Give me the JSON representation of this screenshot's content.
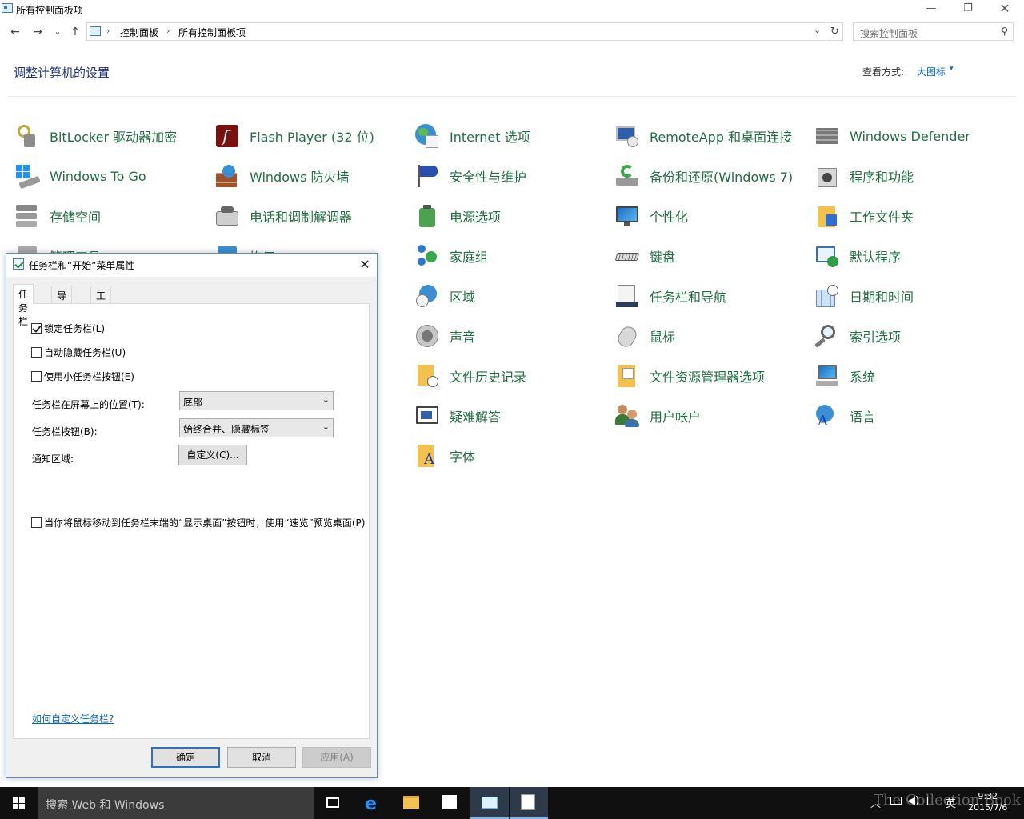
{
  "window": {
    "title": "所有控制面板项",
    "minimize": "—",
    "maximize": "❐",
    "close": "✕"
  },
  "nav": {
    "back": "←",
    "forward": "→",
    "recent": "⌄",
    "up": "↑",
    "breadcrumb": [
      "控制面板",
      "所有控制面板项"
    ],
    "separator": "›",
    "dropdown": "⌄",
    "refresh": "↻"
  },
  "search": {
    "placeholder": "搜索控制面板",
    "icon": "⚲"
  },
  "header": {
    "title": "调整计算机的设置",
    "view_by_label": "查看方式:",
    "view_by_value": "大图标",
    "view_by_arrow": "▾"
  },
  "items": [
    "BitLocker 驱动器加密",
    "Flash Player (32 位)",
    "Internet 选项",
    "RemoteApp 和桌面连接",
    "Windows Defender",
    "Windows To Go",
    "Windows 防火墙",
    "安全性与维护",
    "备份和还原(Windows 7)",
    "程序和功能",
    "存储空间",
    "电话和调制解调器",
    "电源选项",
    "个性化",
    "工作文件夹",
    "管理工具",
    "恢复",
    "家庭组",
    "键盘",
    "默认程序",
    "区域",
    "任务栏和导航",
    "日期和时间",
    "声音",
    "鼠标",
    "索引选项",
    "文件历史记录",
    "文件资源管理器选项",
    "系统",
    "疑难解答",
    "用户帐户",
    "语言",
    "字体"
  ],
  "dialog": {
    "title": "任务栏和“开始”菜单属性",
    "close": "✕",
    "tabs": [
      "任务栏",
      "导航",
      "工具栏"
    ],
    "lock_taskbar": "锁定任务栏(L)",
    "lock_taskbar_checked": true,
    "auto_hide": "自动隐藏任务栏(U)",
    "auto_hide_checked": false,
    "small_buttons": "使用小任务栏按钮(E)",
    "small_buttons_checked": false,
    "position_label": "任务栏在屏幕上的位置(T):",
    "position_value": "底部",
    "buttons_label": "任务栏按钮(B):",
    "buttons_value": "始终合并、隐藏标签",
    "notify_label": "通知区域:",
    "customize_button": "自定义(C)...",
    "peek_text": "当你将鼠标移动到任务栏末端的“显示桌面”按钮时，使用“速览”预览桌面(P)",
    "peek_checked": false,
    "help_link": "如何自定义任务栏?",
    "ok": "确定",
    "cancel": "取消",
    "apply": "应用(A)",
    "combo_arrow": "⌄"
  },
  "taskbar": {
    "search_placeholder": "搜索 Web 和 Windows",
    "tray_chevron": "︿",
    "tray_lang": "英",
    "time": "9:32",
    "date": "2015/7/6",
    "watermark": "The Collection Book"
  }
}
